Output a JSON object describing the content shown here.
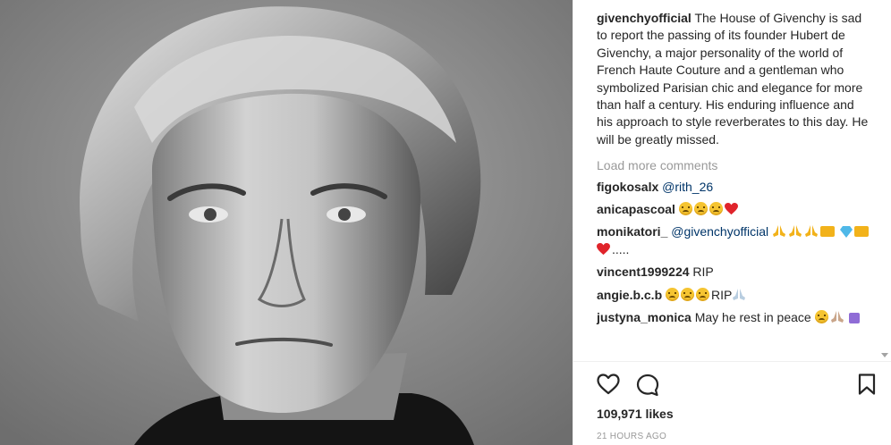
{
  "post": {
    "photo": {
      "alt": "black and white portrait photograph"
    },
    "caption": {
      "username": "givenchyofficial",
      "text": "The House of Givenchy is sad to report the passing of its founder Hubert de Givenchy, a major personality of the world of French Haute Couture and a gentleman who symbolized Parisian chic and elegance for more than half a century. His enduring influence and his approach to style reverberates to this day. He will be greatly missed."
    },
    "load_more": "Load more comments",
    "comments": [
      {
        "username": "figokosalx",
        "mention": "@rith_26",
        "text": ""
      },
      {
        "username": "anicapascoal",
        "text": ""
      },
      {
        "username": "monikatori_",
        "mention": "@givenchyofficial",
        "text": "....."
      },
      {
        "username": "vincent1999224",
        "text": "RIP"
      },
      {
        "username": "angie.b.c.b",
        "text": "RIP"
      },
      {
        "username": "justyna_monica",
        "text": "May he rest in peace"
      }
    ],
    "likes": "109,971 likes",
    "timestamp": "21 HOURS AGO"
  }
}
